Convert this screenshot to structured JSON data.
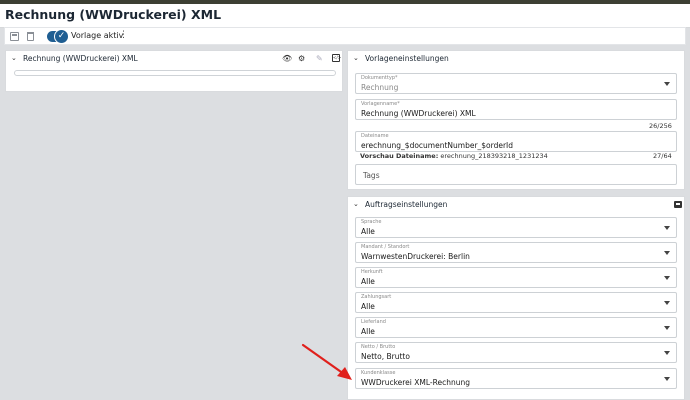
{
  "header": {
    "title": "Rechnung (WWDruckerei) XML"
  },
  "toolbar": {
    "toggle_label": "Vorlage aktiv",
    "icons": [
      "save-icon",
      "trash-icon",
      "check-icon",
      "more-vertical-icon"
    ]
  },
  "left_panel": {
    "title": "Rechnung (WWDruckerei) XML",
    "icons": [
      "chevron-down-icon",
      "eye-icon",
      "gear-icon",
      "pencil-icon",
      "code-icon"
    ]
  },
  "template_settings": {
    "title": "Vorlageneinstellungen",
    "document_type": {
      "label": "Dokumenttyp*",
      "value": "Rechnung"
    },
    "template_name": {
      "label": "Vorlagenname*",
      "value": "Rechnung (WWDruckerei) XML",
      "counter": "26/256"
    },
    "filename": {
      "label": "Dateiname",
      "value": "erechnung_$documentNumber_$orderId",
      "counter": "27/64"
    },
    "preview_label": "Vorschau Dateiname:",
    "preview_value": "erechnung_218393218_1231234",
    "tags_placeholder": "Tags"
  },
  "order_settings": {
    "title": "Auftragseinstellungen",
    "fields": [
      {
        "label": "Sprache",
        "value": "Alle"
      },
      {
        "label": "Mandant / Standort",
        "value": "WarnwestenDruckerei: Berlin"
      },
      {
        "label": "Herkunft",
        "value": "Alle"
      },
      {
        "label": "Zahlungsart",
        "value": "Alle"
      },
      {
        "label": "Lieferland",
        "value": "Alle"
      },
      {
        "label": "Netto / Brutto",
        "value": "Netto, Brutto"
      },
      {
        "label": "Kundenklasse",
        "value": "WWDruckerei XML-Rechnung"
      }
    ]
  },
  "colors": {
    "accent": "#1f5e92",
    "annotation_arrow": "#e0201c",
    "topbar": "#3d3f33"
  }
}
